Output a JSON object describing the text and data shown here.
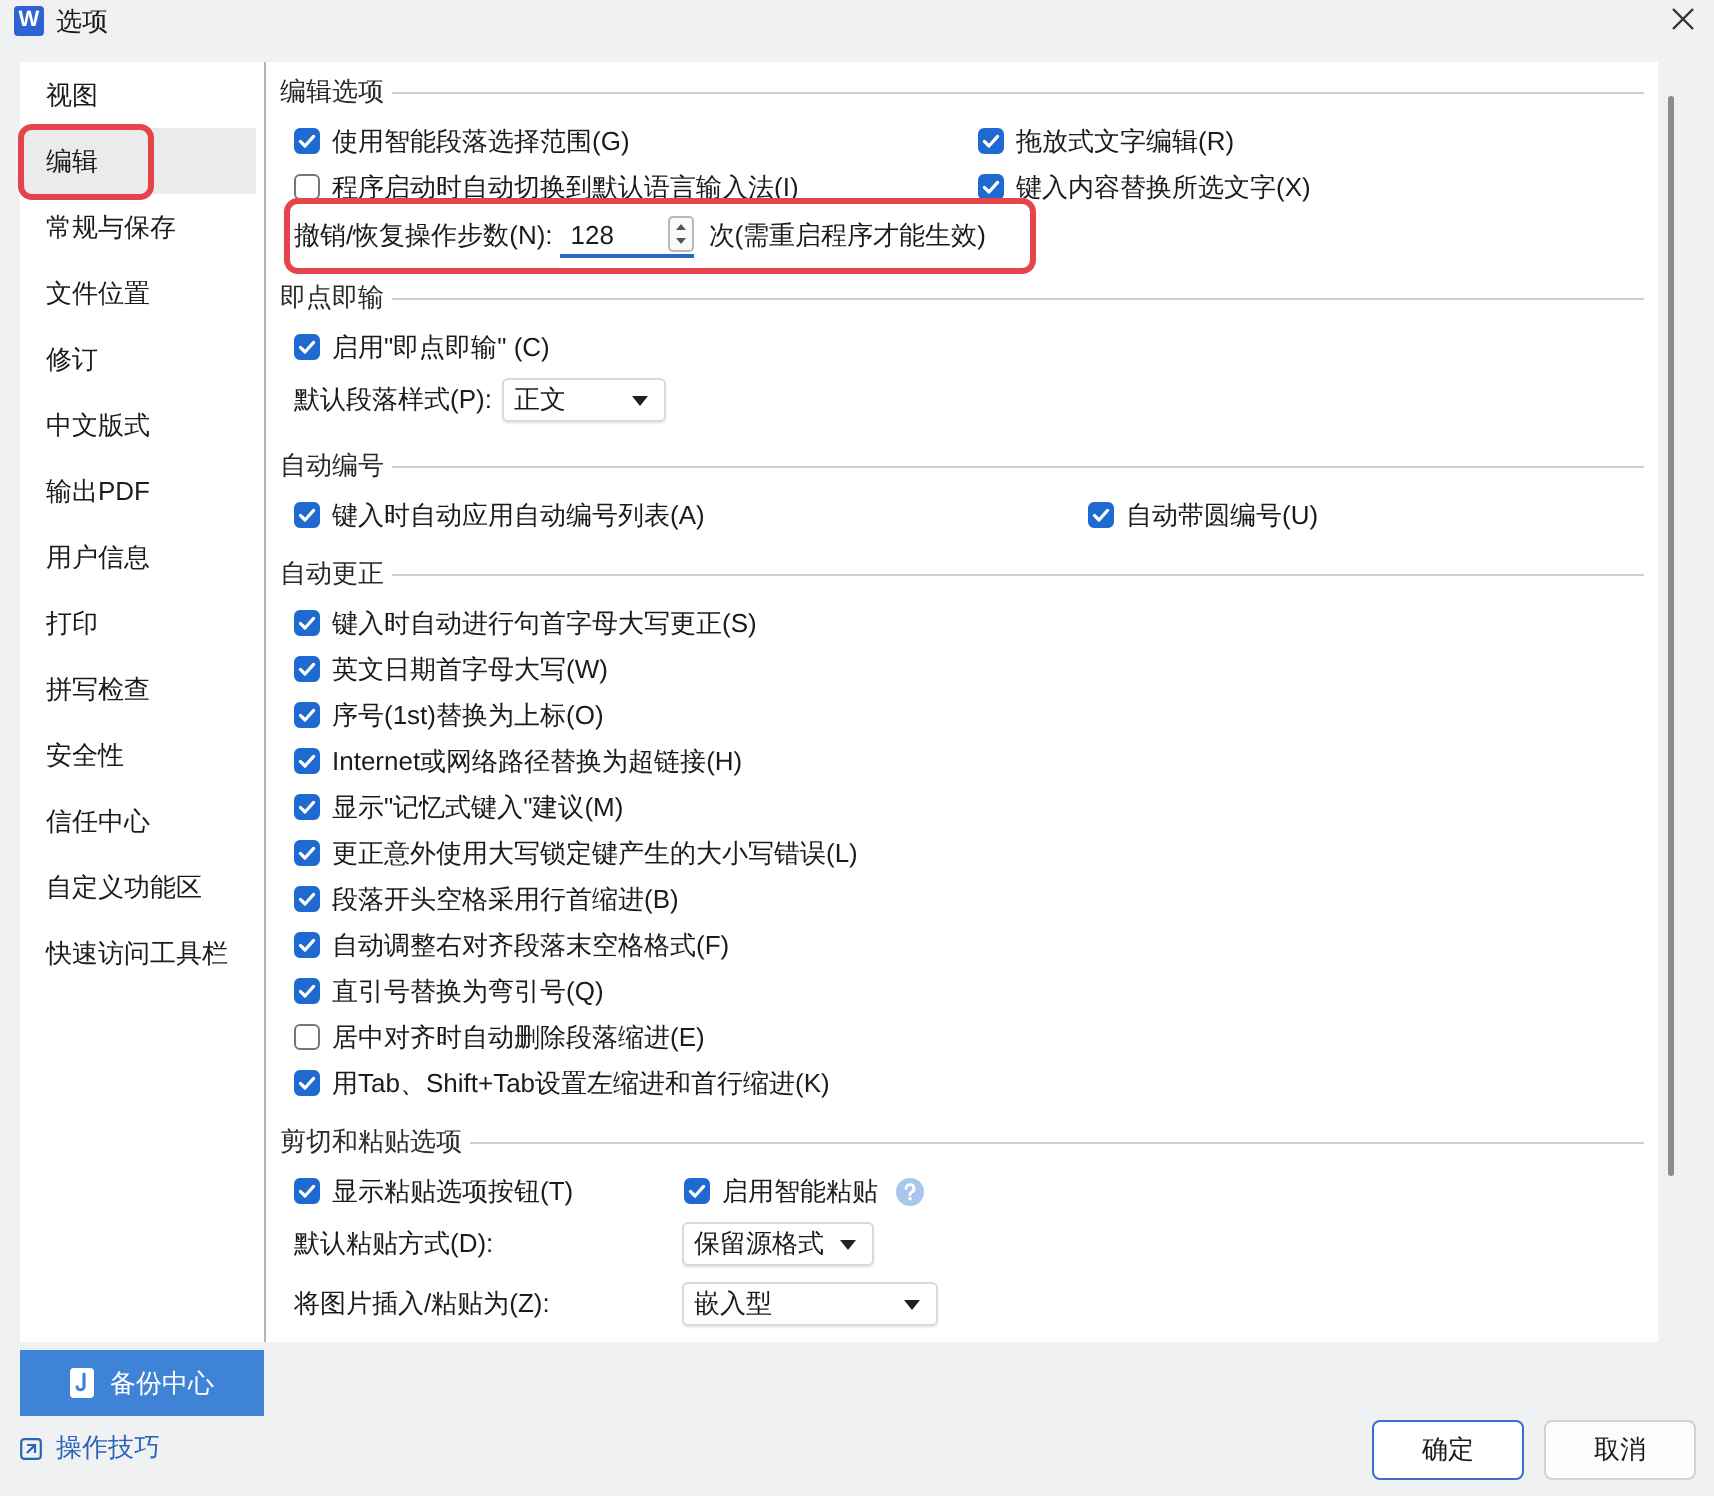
{
  "window": {
    "logo_text": "W",
    "title": "选项"
  },
  "sidebar": {
    "items": [
      {
        "label": "视图",
        "selected": false,
        "marked": false
      },
      {
        "label": "编辑",
        "selected": true,
        "marked": true
      },
      {
        "label": "常规与保存",
        "selected": false,
        "marked": false
      },
      {
        "label": "文件位置",
        "selected": false,
        "marked": false
      },
      {
        "label": "修订",
        "selected": false,
        "marked": false
      },
      {
        "label": "中文版式",
        "selected": false,
        "marked": false
      },
      {
        "label": "输出PDF",
        "selected": false,
        "marked": false
      },
      {
        "label": "用户信息",
        "selected": false,
        "marked": false
      },
      {
        "label": "打印",
        "selected": false,
        "marked": false
      },
      {
        "label": "拼写检查",
        "selected": false,
        "marked": false
      },
      {
        "label": "安全性",
        "selected": false,
        "marked": false
      },
      {
        "label": "信任中心",
        "selected": false,
        "marked": false
      },
      {
        "label": "自定义功能区",
        "selected": false,
        "marked": false
      },
      {
        "label": "快速访问工具栏",
        "selected": false,
        "marked": false
      }
    ]
  },
  "sections": [
    {
      "title": "编辑选项",
      "rows": [
        {
          "kind": "checks",
          "items": [
            {
              "label": "使用智能段落选择范围(G)",
              "checked": true
            },
            {
              "label": "拖放式文字编辑(R)",
              "checked": true
            }
          ]
        },
        {
          "kind": "checks",
          "items": [
            {
              "label": "程序启动时自动切换到默认语言输入法(I)",
              "checked": false
            },
            {
              "label": "键入内容替换所选文字(X)",
              "checked": true
            }
          ]
        },
        {
          "kind": "spin",
          "label": "撤销/恢复操作步数(N):",
          "value": "128",
          "suffix": "次(需重启程序才能生效)",
          "marked": true
        }
      ]
    },
    {
      "title": "即点即输",
      "rows": [
        {
          "kind": "checks",
          "items": [
            {
              "label": "启用\"即点即输\" (C)",
              "checked": true
            }
          ]
        },
        {
          "kind": "select",
          "label": "默认段落样式(P):",
          "value": "正文"
        }
      ]
    },
    {
      "title": "自动编号",
      "rows": [
        {
          "kind": "checks",
          "items": [
            {
              "label": "键入时自动应用自动编号列表(A)",
              "checked": true
            },
            {
              "label": "自动带圆编号(U)",
              "checked": true
            }
          ]
        }
      ]
    },
    {
      "title": "自动更正",
      "rows": [
        {
          "kind": "checks",
          "items": [
            {
              "label": "键入时自动进行句首字母大写更正(S)",
              "checked": true
            }
          ]
        },
        {
          "kind": "checks",
          "items": [
            {
              "label": "英文日期首字母大写(W)",
              "checked": true
            }
          ]
        },
        {
          "kind": "checks",
          "items": [
            {
              "label": "序号(1st)替换为上标(O)",
              "checked": true
            }
          ]
        },
        {
          "kind": "checks",
          "items": [
            {
              "label": "Internet或网络路径替换为超链接(H)",
              "checked": true
            }
          ]
        },
        {
          "kind": "checks",
          "items": [
            {
              "label": "显示\"记忆式键入\"建议(M)",
              "checked": true
            }
          ]
        },
        {
          "kind": "checks",
          "items": [
            {
              "label": "更正意外使用大写锁定键产生的大小写错误(L)",
              "checked": true
            }
          ]
        },
        {
          "kind": "checks",
          "items": [
            {
              "label": "段落开头空格采用行首缩进(B)",
              "checked": true
            }
          ]
        },
        {
          "kind": "checks",
          "items": [
            {
              "label": "自动调整右对齐段落末空格格式(F)",
              "checked": true
            }
          ]
        },
        {
          "kind": "checks",
          "items": [
            {
              "label": "直引号替换为弯引号(Q)",
              "checked": true
            }
          ]
        },
        {
          "kind": "checks",
          "items": [
            {
              "label": "居中对齐时自动删除段落缩进(E)",
              "checked": false
            }
          ]
        },
        {
          "kind": "checks",
          "items": [
            {
              "label": "用Tab、Shift+Tab设置左缩进和首行缩进(K)",
              "checked": true
            }
          ]
        }
      ]
    },
    {
      "title": "剪切和粘贴选项",
      "rows": [
        {
          "kind": "checks",
          "items": [
            {
              "label": "显示粘贴选项按钮(T)",
              "checked": true
            },
            {
              "label": "启用智能粘贴",
              "checked": true,
              "help": true
            }
          ]
        },
        {
          "kind": "select",
          "label": "默认粘贴方式(D):",
          "value": "保留源格式"
        },
        {
          "kind": "select",
          "label": "将图片插入/粘贴为(Z):",
          "value": "嵌入型"
        }
      ]
    }
  ],
  "backup_button": {
    "label": "备份中心"
  },
  "tips_link": {
    "label": "操作技巧"
  },
  "buttons": [
    {
      "label": "确定",
      "kind": "primary"
    },
    {
      "label": "取消",
      "kind": "secondary"
    }
  ]
}
